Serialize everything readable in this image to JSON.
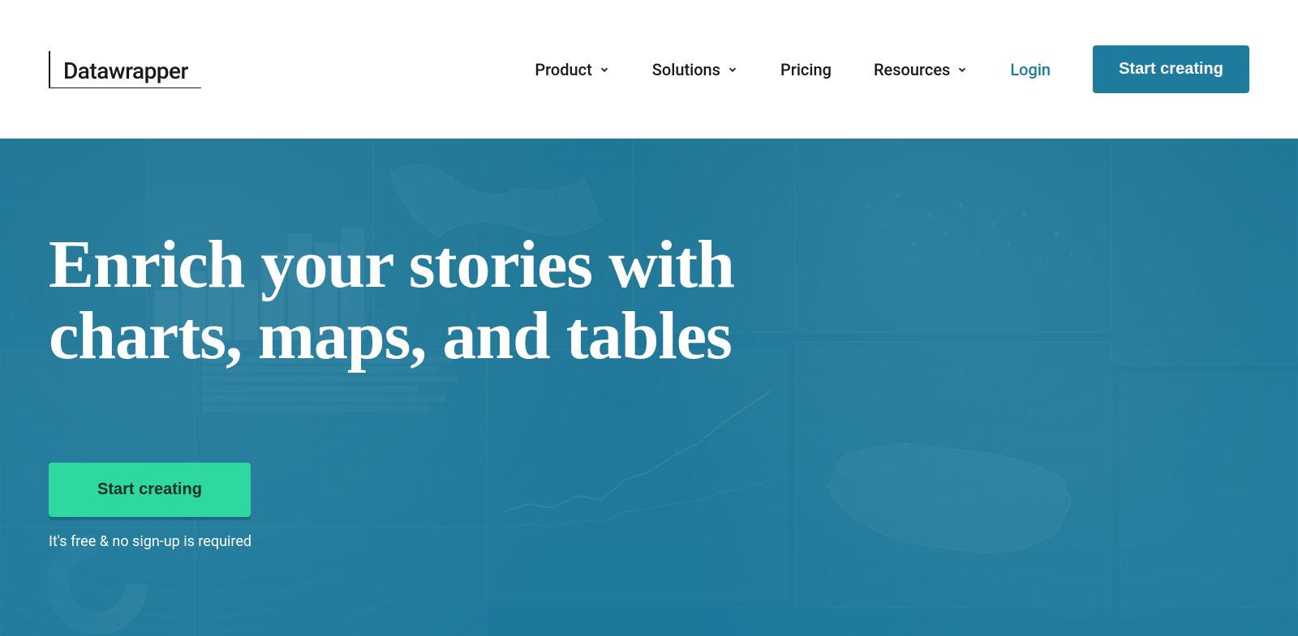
{
  "brand": {
    "name": "Datawrapper"
  },
  "nav": {
    "items": [
      {
        "label": "Product",
        "has_dropdown": true
      },
      {
        "label": "Solutions",
        "has_dropdown": true
      },
      {
        "label": "Pricing",
        "has_dropdown": false
      },
      {
        "label": "Resources",
        "has_dropdown": true
      }
    ],
    "login_label": "Login",
    "cta_label": "Start creating"
  },
  "hero": {
    "heading": "Enrich your stories with charts, maps, and tables",
    "cta_label": "Start creating",
    "subtext": "It's free & no sign-up is required"
  },
  "colors": {
    "primary": "#1e7b9e",
    "accent": "#2fd89f",
    "text_dark": "#1a1a1a",
    "text_light": "#ffffff"
  }
}
